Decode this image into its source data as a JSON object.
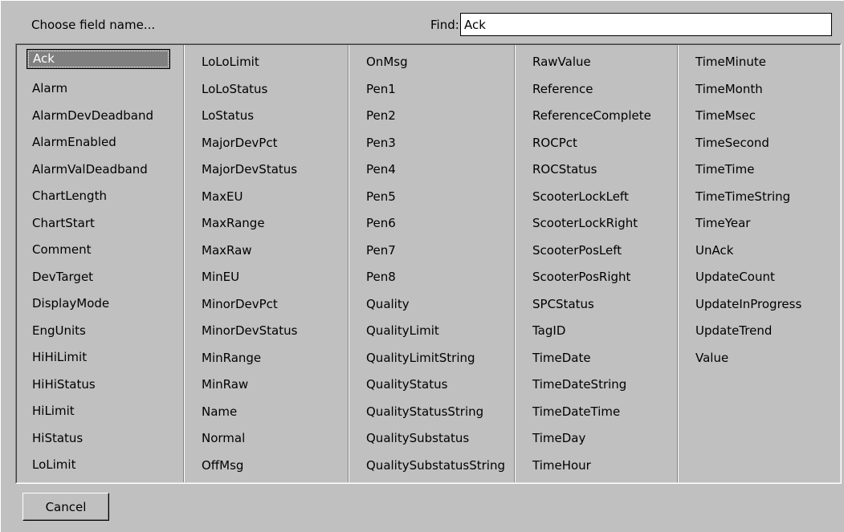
{
  "header": {
    "prompt": "Choose field name...",
    "find_label": "Find:",
    "find_value": "Ack"
  },
  "list": {
    "selected": "Ack",
    "columns": [
      [
        "Ack",
        "Alarm",
        "AlarmDevDeadband",
        "AlarmEnabled",
        "AlarmValDeadband",
        "ChartLength",
        "ChartStart",
        "Comment",
        "DevTarget",
        "DisplayMode",
        "EngUnits",
        "HiHiLimit",
        "HiHiStatus",
        "HiLimit",
        "HiStatus",
        "LoLimit"
      ],
      [
        "LoLoLimit",
        "LoLoStatus",
        "LoStatus",
        "MajorDevPct",
        "MajorDevStatus",
        "MaxEU",
        "MaxRange",
        "MaxRaw",
        "MinEU",
        "MinorDevPct",
        "MinorDevStatus",
        "MinRange",
        "MinRaw",
        "Name",
        "Normal",
        "OffMsg"
      ],
      [
        "OnMsg",
        "Pen1",
        "Pen2",
        "Pen3",
        "Pen4",
        "Pen5",
        "Pen6",
        "Pen7",
        "Pen8",
        "Quality",
        "QualityLimit",
        "QualityLimitString",
        "QualityStatus",
        "QualityStatusString",
        "QualitySubstatus",
        "QualitySubstatusString"
      ],
      [
        "RawValue",
        "Reference",
        "ReferenceComplete",
        "ROCPct",
        "ROCStatus",
        "ScooterLockLeft",
        "ScooterLockRight",
        "ScooterPosLeft",
        "ScooterPosRight",
        "SPCStatus",
        "TagID",
        "TimeDate",
        "TimeDateString",
        "TimeDateTime",
        "TimeDay",
        "TimeHour"
      ],
      [
        "TimeMinute",
        "TimeMonth",
        "TimeMsec",
        "TimeSecond",
        "TimeTime",
        "TimeTimeString",
        "TimeYear",
        "UnAck",
        "UpdateCount",
        "UpdateInProgress",
        "UpdateTrend",
        "Value"
      ]
    ]
  },
  "footer": {
    "cancel_label": "Cancel"
  },
  "colors": {
    "dialog_bg": "#c0c0c0",
    "selection_bg": "#808080",
    "selection_text": "#ffffff"
  }
}
